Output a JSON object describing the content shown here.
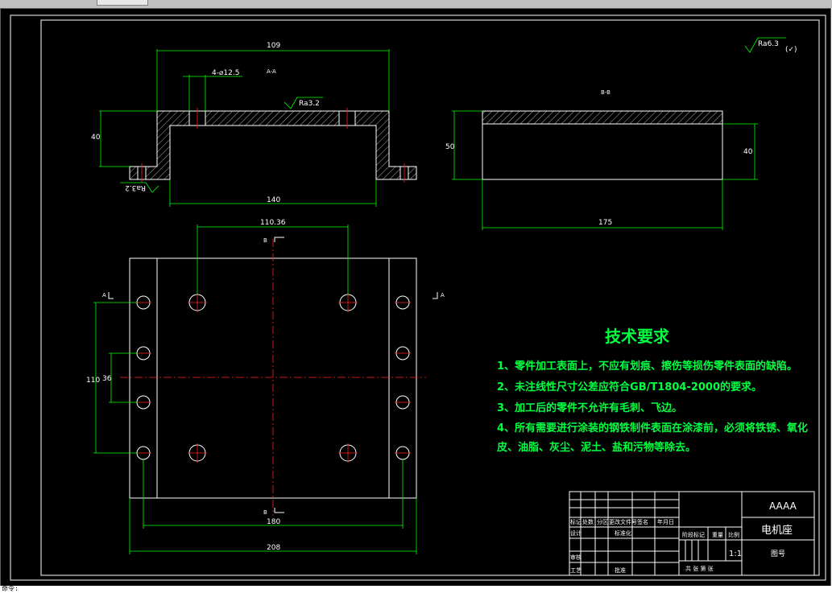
{
  "window": {
    "cmd_prompt": "命令:"
  },
  "drawing": {
    "roughness_general": "Ra6.3",
    "roughness_general_suffix": "(✓)",
    "view_a": {
      "label": "A-A",
      "dim_top": "109",
      "dim_holes": "4-⌀12.5",
      "roughness_top": "Ra3.2",
      "roughness_left": "Ra3.2",
      "dim_height": "40",
      "dim_bottom": "140"
    },
    "view_b": {
      "label": "B-B",
      "dim_left": "50",
      "dim_right": "40",
      "dim_bottom": "175"
    },
    "plan_view": {
      "dim_top": "110.36",
      "dim_left_outer": "110",
      "dim_left_inner": "36",
      "dim_bottom_inner": "180",
      "dim_bottom_outer": "208",
      "section_a_top": "A",
      "section_a_bottom": "A",
      "section_b_top": "B",
      "section_b_bottom": "B"
    },
    "tech_requirements": {
      "title": "技术要求",
      "items": [
        "1、零件加工表面上，不应有划痕、擦伤等损伤零件表面的缺陷。",
        "2、未注线性尺寸公差应符合GB/T1804-2000的要求。",
        "3、加工后的零件不允许有毛刺、飞边。",
        "4、所有需要进行涂装的钢铁制件表面在涂漆前，必须将铁锈、氧化",
        "皮、油脂、灰尘、泥土、盐和污物等除去。"
      ]
    },
    "title_block": {
      "company": "AAAA",
      "part_name": "电机座",
      "drawing_no": "图号",
      "scale": "1:1",
      "row_labels": {
        "mark": "标记",
        "count": "处数",
        "zone": "分区",
        "change_doc": "更改文件号",
        "sign": "签名",
        "date": "年月日",
        "design": "设计",
        "standardize": "标准化",
        "stage_mark": "阶段标记",
        "weight": "重量",
        "ratio": "比例",
        "review": "审核",
        "process": "工艺",
        "approve": "批准",
        "sheets": "共 张 第 张"
      }
    }
  }
}
